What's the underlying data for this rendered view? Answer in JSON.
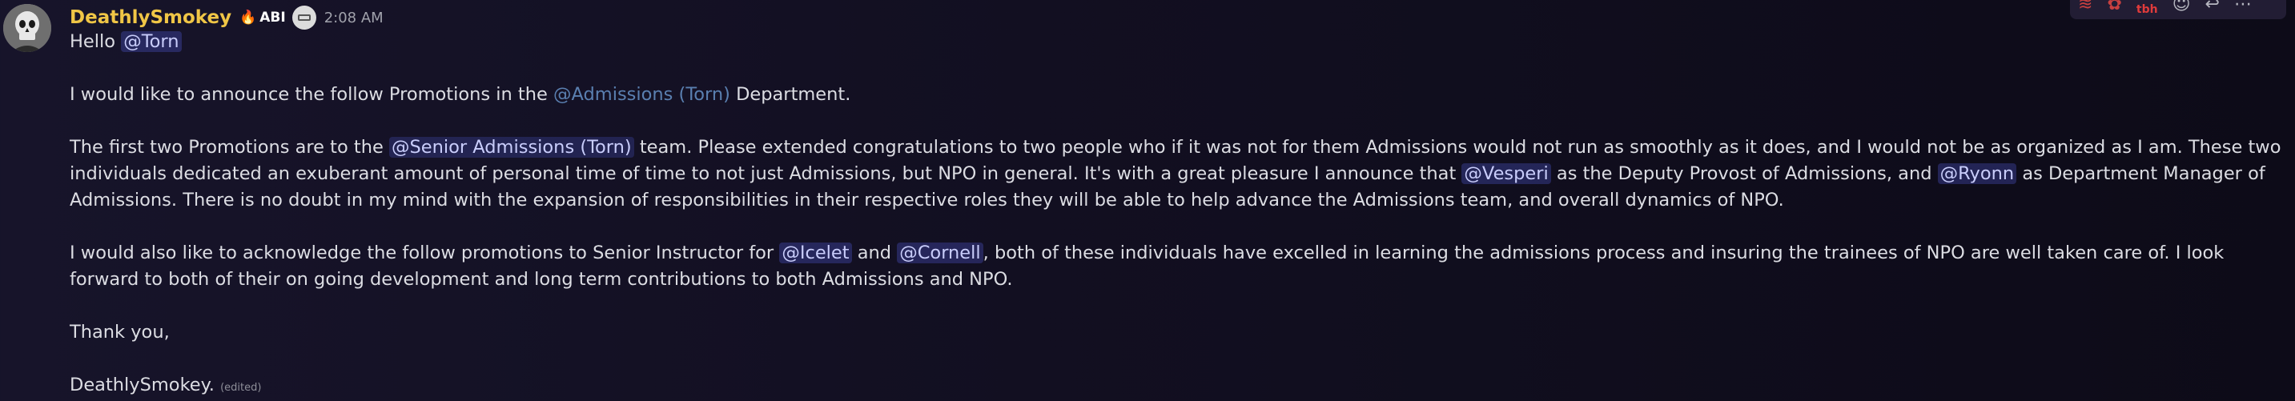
{
  "author": {
    "name": "DeathlySmokey",
    "tag_icon": "fire-icon",
    "tag_label": "ABI",
    "badge_icon": "guild-badge-icon",
    "timestamp": "2:08 AM"
  },
  "message": {
    "greeting": "Hello ",
    "greeting_mention": "@Torn",
    "intro_before": "I would like to announce the follow Promotions in the ",
    "intro_role": "@Admissions (Torn)",
    "intro_after": "  Department.",
    "para2_before": "The first two Promotions are to the ",
    "para2_role": "@Senior Admissions (Torn)",
    "para2_mid1": "  team. Please extended congratulations to two people who if it was not for them Admissions would not run as smoothly as it does, and I would not be as organized as I am. These two individuals dedicated an exuberant amount of personal time of time to not just Admissions, but NPO in general.  It's with a great pleasure I announce that ",
    "para2_mention1": "@Vesperi",
    "para2_mid2": "  as the Deputy Provost of Admissions, and ",
    "para2_mention2": "@Ryonn",
    "para2_after": " as Department Manager of Admissions.  There is no doubt in my mind with the expansion of responsibilities in their respective roles they will be able to help advance the Admissions team, and overall dynamics of NPO.",
    "para3_before": "I would also like to acknowledge the follow promotions to Senior Instructor for ",
    "para3_mention1": "@Icelet",
    "para3_mid": "  and ",
    "para3_mention2": "@Cornell",
    "para3_after": ", both of these individuals  have excelled in learning the admissions process and insuring the trainees of NPO are well taken care of. I look forward to both of their on going development and long term contributions to both Admissions and NPO.",
    "closing": "Thank you,",
    "signature": "DeathlySmokey.",
    "edited": "(edited)"
  },
  "toolbar": {
    "icons": [
      "reaction-icon",
      "reaction-icon",
      "add-reaction-icon",
      "reply-icon",
      "more-icon"
    ],
    "reaction_text": "tbh"
  }
}
